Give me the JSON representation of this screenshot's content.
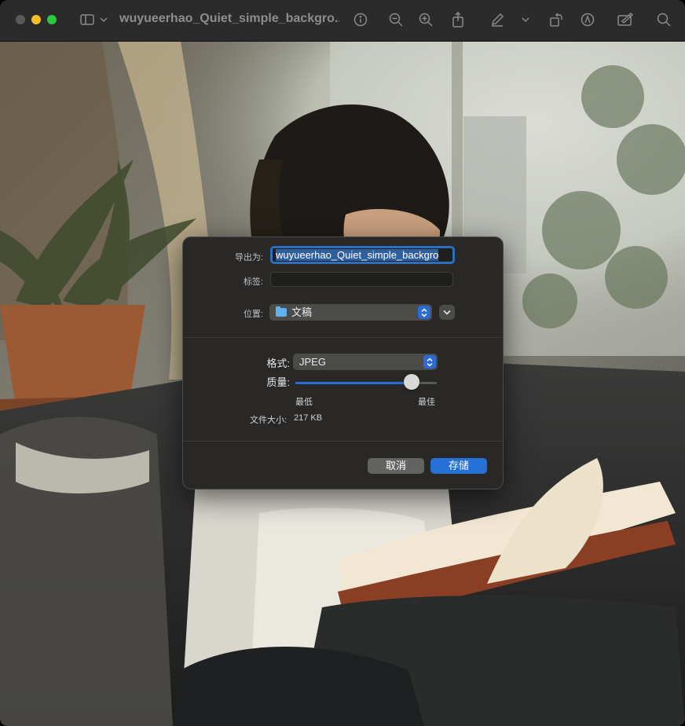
{
  "window": {
    "title": "wuyueerhao_Quiet_simple_backgro..."
  },
  "toolbar": {
    "icons": [
      "sidebar-icon",
      "chevron-down-icon",
      "info-icon",
      "zoom-out-icon",
      "zoom-in-icon",
      "share-icon",
      "markup-pen-icon",
      "chevron-down-icon",
      "rotate-icon",
      "markup-circle-icon",
      "form-fill-icon",
      "search-icon"
    ]
  },
  "export_dialog": {
    "export_as_label": "导出为:",
    "filename_value": "wuyueerhao_Quiet_simple_backgro",
    "tags_label": "标签:",
    "tags_value": "",
    "location_label": "位置:",
    "location_value": "文稿",
    "format_label": "格式:",
    "format_value": "JPEG",
    "quality_label": "质量:",
    "quality_value": 0.82,
    "quality_min_label": "最低",
    "quality_max_label": "最佳",
    "file_size_label": "文件大小:",
    "file_size_value": "217 KB",
    "cancel_label": "取消",
    "save_label": "存储",
    "accent_color": "#2771d6"
  }
}
